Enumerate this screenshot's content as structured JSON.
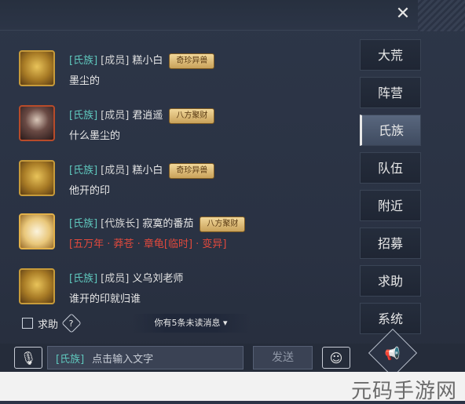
{
  "close_icon_glyph": "✕",
  "messages": [
    {
      "clan_tag": "[氏族]",
      "role_tag": "[成员]",
      "name": "糕小白",
      "title": "奇珍异兽",
      "text": "墨尘的",
      "text_color": "#e8e8e8",
      "avatar": "dragon-avatar"
    },
    {
      "clan_tag": "[氏族]",
      "role_tag": "[成员]",
      "name": "君逍遥",
      "title": "八方聚财",
      "text": "什么墨尘的",
      "text_color": "#e8e8e8",
      "avatar": "girl-avatar"
    },
    {
      "clan_tag": "[氏族]",
      "role_tag": "[成员]",
      "name": "糕小白",
      "title": "奇珍异兽",
      "text": "他开的印",
      "text_color": "#e8e8e8",
      "avatar": "dragon-avatar"
    },
    {
      "clan_tag": "[氏族]",
      "role_tag": "[代族长]",
      "name": "寂寞的番茄",
      "title": "八方聚财",
      "text": "[五万年 · 莽苍 · 章龟[临时] · 变异]",
      "text_color": "#e0493d",
      "avatar": "ox-avatar"
    },
    {
      "clan_tag": "[氏族]",
      "role_tag": "[成员]",
      "name": "义乌刘老师",
      "text": "谁开的印就归谁",
      "text_color": "#e8e8e8",
      "avatar": "dragon-avatar"
    }
  ],
  "help_checkbox_label": "求助",
  "help_glyph": "?",
  "unread_notice": "你有5条未读消息 ▾",
  "tabs": [
    {
      "label": "大荒",
      "active": false
    },
    {
      "label": "阵营",
      "active": false
    },
    {
      "label": "氏族",
      "active": true
    },
    {
      "label": "队伍",
      "active": false
    },
    {
      "label": "附近",
      "active": false
    },
    {
      "label": "招募",
      "active": false
    },
    {
      "label": "求助",
      "active": false
    },
    {
      "label": "系统",
      "active": false
    }
  ],
  "input": {
    "channel_tag": "[氏族]",
    "placeholder": "点击输入文字"
  },
  "send_label": "发送",
  "voice_glyph": "🎙",
  "emoji_glyph": "☺",
  "horn_glyph": "📢",
  "watermark": "元码手游网"
}
